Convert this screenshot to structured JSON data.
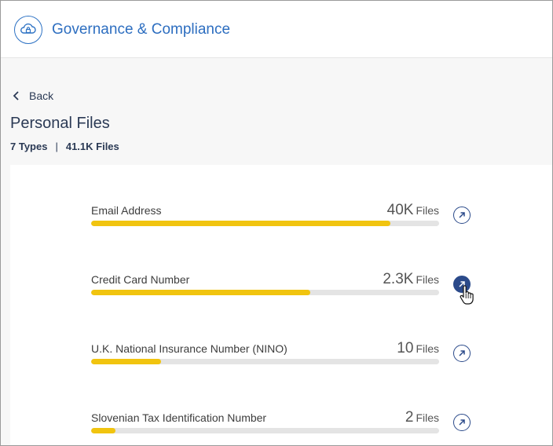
{
  "header": {
    "title": "Governance & Compliance",
    "logo_icon": "cloud-lock-icon",
    "accent_color": "#2d6ec0"
  },
  "nav": {
    "back_label": "Back"
  },
  "page": {
    "title": "Personal Files",
    "types_label": "7 Types",
    "separator": "|",
    "files_label": "41.1K Files"
  },
  "rows": [
    {
      "name": "Email Address",
      "count": "40K",
      "unit": "Files",
      "fill_fraction": 0.86
    },
    {
      "name": "Credit Card Number",
      "count": "2.3K",
      "unit": "Files",
      "fill_fraction": 0.63
    },
    {
      "name": "U.K. National Insurance Number (NINO)",
      "count": "10",
      "unit": "Files",
      "fill_fraction": 0.2
    },
    {
      "name": "Slovenian Tax Identification Number",
      "count": "2",
      "unit": "Files",
      "fill_fraction": 0.07
    }
  ],
  "colors": {
    "bar_fill": "#f1c40f",
    "bar_track": "#e4e4e4",
    "link_icon": "#2b4a8a"
  }
}
